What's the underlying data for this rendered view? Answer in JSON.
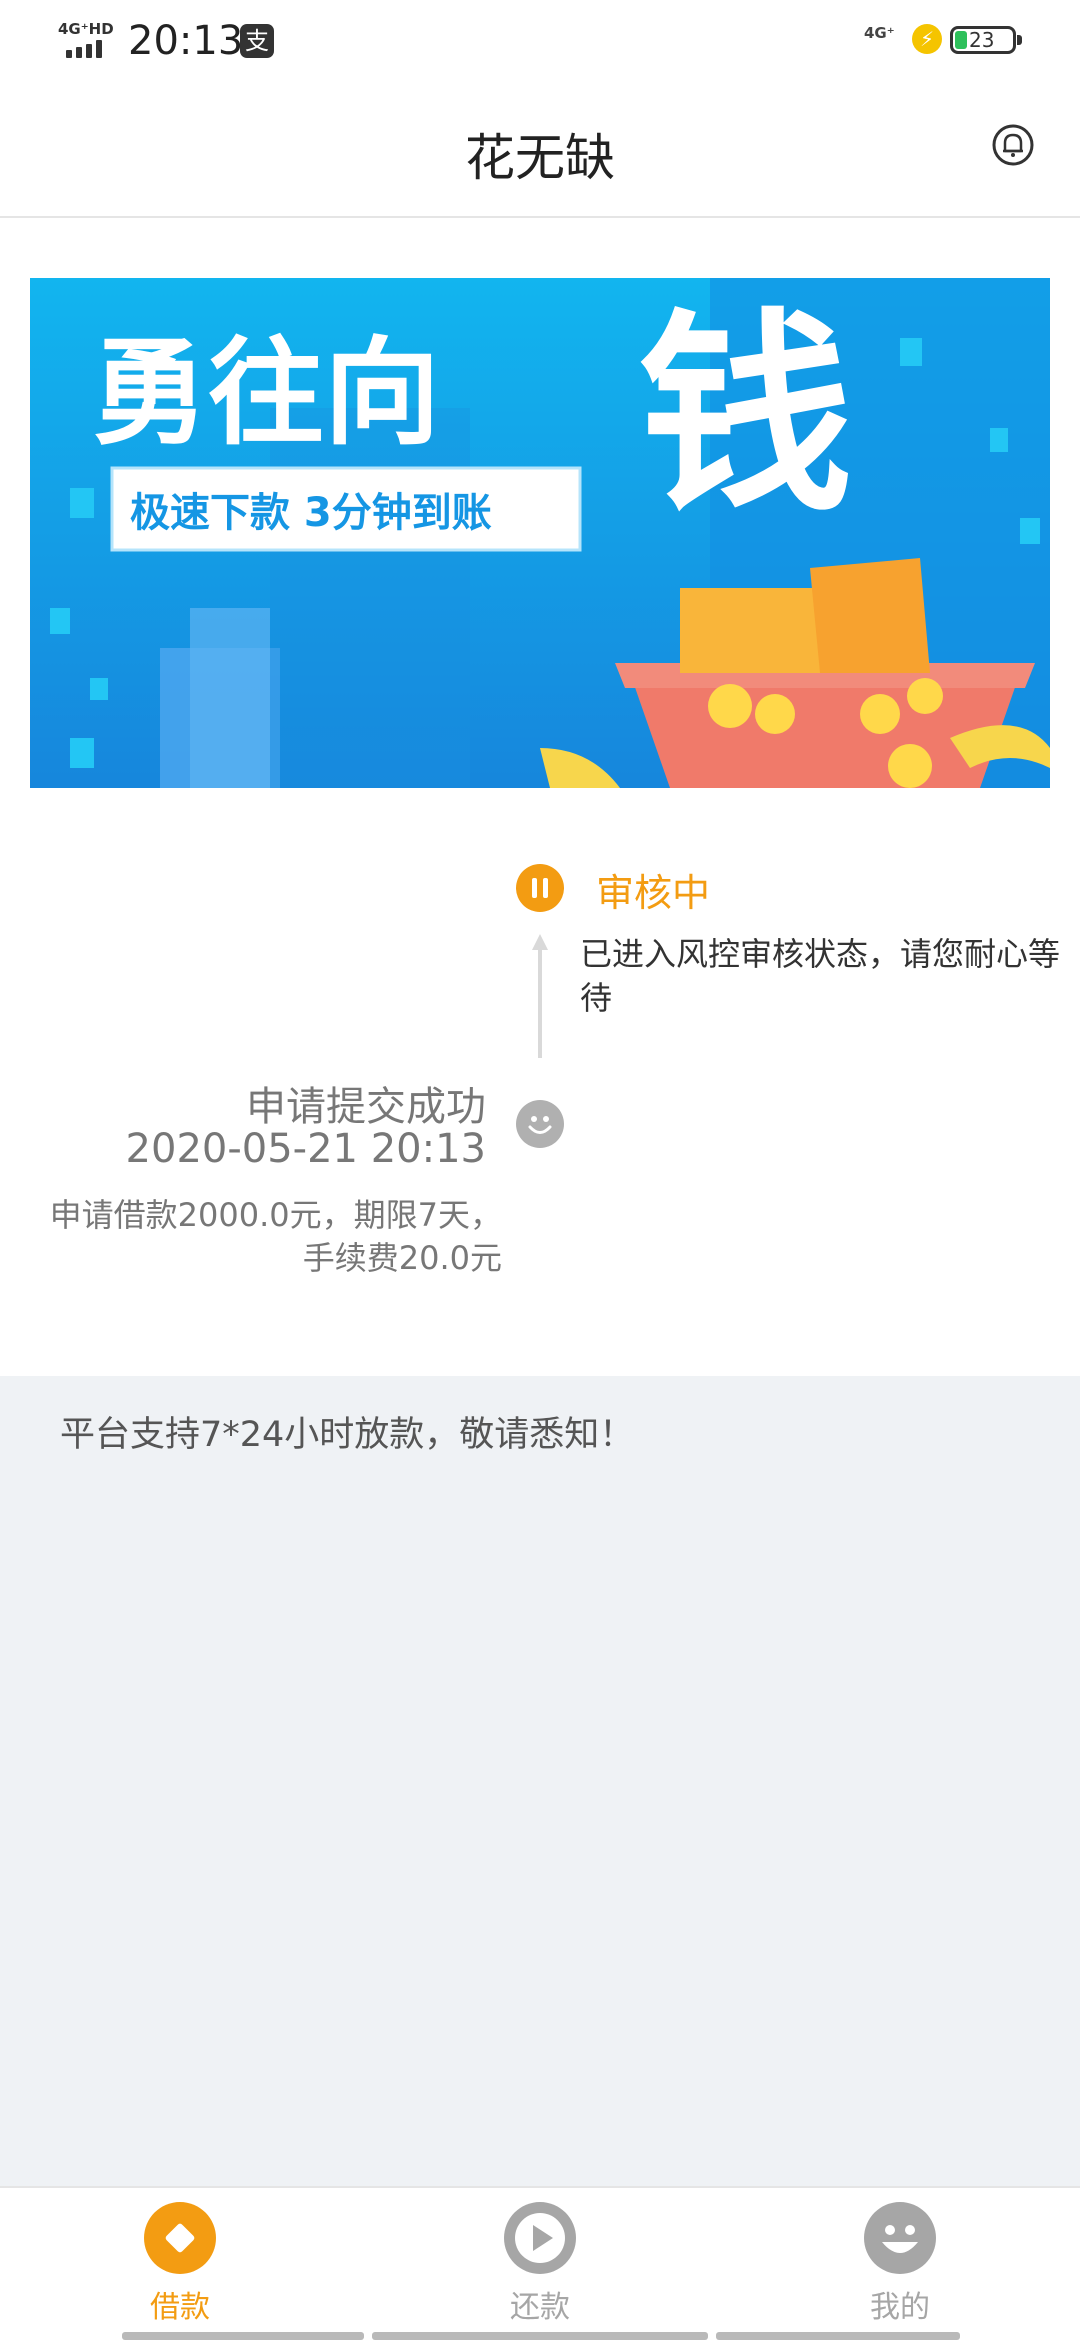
{
  "status_bar": {
    "network_left": "4G⁺HD",
    "time": "20:13",
    "app_icon": "alipay-icon",
    "network_right": "4G⁺",
    "battery_level": "23"
  },
  "header": {
    "title": "花无缺",
    "bell_icon": "bell-icon"
  },
  "banner": {
    "headline_main": "勇往向",
    "headline_big": "钱",
    "sub": "极速下款  3分钟到账"
  },
  "timeline": {
    "pending": {
      "status": "审核中",
      "desc": "已进入风控审核状态，请您耐心等待"
    },
    "submitted": {
      "title": "申请提交成功",
      "time": "2020-05-21 20:13",
      "detail": "申请借款2000.0元，期限7天，手续费20.0元"
    }
  },
  "notice": "平台支持7*24小时放款，敬请悉知！",
  "tabs": [
    {
      "label": "借款",
      "active": true,
      "icon": "diamond-icon"
    },
    {
      "label": "还款",
      "active": false,
      "icon": "play-icon"
    },
    {
      "label": "我的",
      "active": false,
      "icon": "smiley-icon"
    }
  ],
  "colors": {
    "accent": "#f39c12",
    "inactive": "#a6a6a6",
    "banner_bg": "#1aa3e8"
  }
}
